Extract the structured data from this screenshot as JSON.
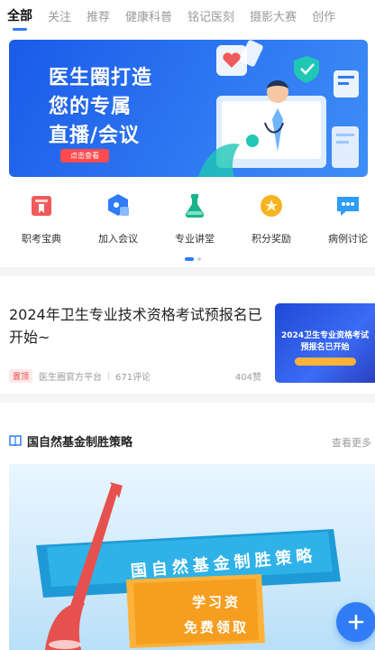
{
  "tabs": [
    "全部",
    "关注",
    "推荐",
    "健康科普",
    "铭记医刻",
    "摄影大赛",
    "创作"
  ],
  "banner": {
    "line1": "医生圈打造",
    "line2": "您的专属",
    "line3": "直播/会议",
    "button": "点击查看"
  },
  "quick_links": [
    {
      "label": "职考宝典",
      "icon": "book-icon",
      "color": "#f05a5a"
    },
    {
      "label": "加入会议",
      "icon": "hexagon-icon",
      "color": "#2f7cf6"
    },
    {
      "label": "专业讲堂",
      "icon": "flask-icon",
      "color": "#19b38a"
    },
    {
      "label": "积分奖励",
      "icon": "coin-icon",
      "color": "#f5b320"
    },
    {
      "label": "病例讨论",
      "icon": "chat-icon",
      "color": "#2f9cf6"
    }
  ],
  "article": {
    "title": "2024年卫生专业技术资格考试预报名已开始~",
    "tag": "置顶",
    "source": "医生圈官方平台",
    "comments": "671评论",
    "likes": "404赞",
    "thumb_line1": "2024卫生专业资格考试",
    "thumb_line2": "预报名已开始"
  },
  "section": {
    "title": "国自然基金制胜策略",
    "more": "查看更多",
    "promo_title": "国自然基金制胜策略",
    "promo_line1": "学习资",
    "promo_line2": "免费领取"
  },
  "colors": {
    "accent": "#2f7cf6",
    "tag_red": "#e84a4a"
  }
}
